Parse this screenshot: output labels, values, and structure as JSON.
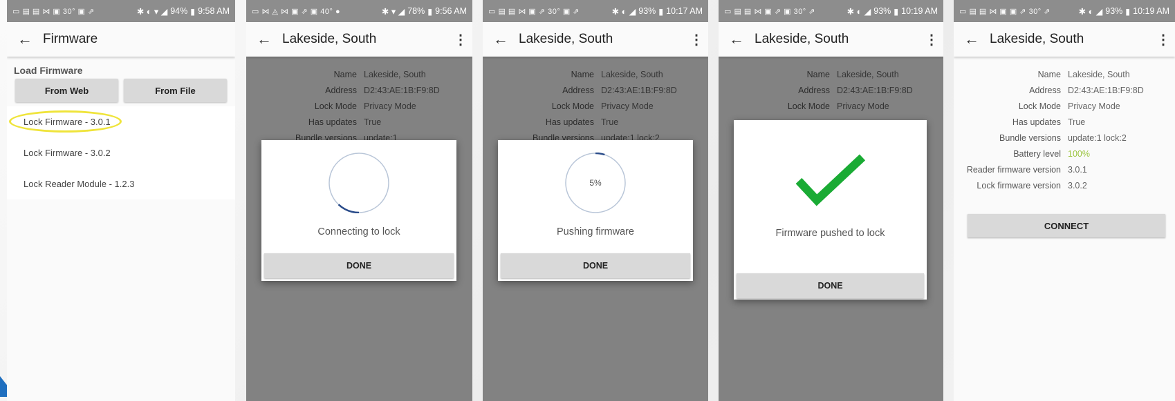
{
  "screens": [
    {
      "status": {
        "icons_left": "▭ ▤ ▤ ⋈ ▣ 30° ▣ ⇗",
        "battery": "94%",
        "time": "9:58 AM"
      },
      "title": "Firmware",
      "section_label": "Load Firmware",
      "buttons": [
        "From Web",
        "From File"
      ],
      "firmware_items": [
        "Lock Firmware - 3.0.1",
        "Lock Firmware - 3.0.2",
        "Lock Reader Module - 1.2.3"
      ]
    },
    {
      "status": {
        "icons_left": "▭ ⋈ ◬ ⋈ ▣ ⇗ ▣ 40° ●",
        "battery": "78%",
        "time": "9:56 AM"
      },
      "title": "Lakeside, South",
      "details": [
        {
          "label": "Name",
          "value": "Lakeside, South"
        },
        {
          "label": "Address",
          "value": "D2:43:AE:1B:F9:8D"
        },
        {
          "label": "Lock Mode",
          "value": "Privacy Mode"
        },
        {
          "label": "Has updates",
          "value": "True"
        },
        {
          "label": "Bundle versions",
          "value": "update:1"
        }
      ],
      "dialog": {
        "message": "Connecting to lock",
        "button": "DONE",
        "progress_text": "",
        "progress": 0.12
      }
    },
    {
      "status": {
        "icons_left": "▭ ▤ ▤ ⋈ ▣ ⇗ 30° ▣ ⇗",
        "battery": "93%",
        "time": "10:17 AM"
      },
      "title": "Lakeside, South",
      "details": [
        {
          "label": "Name",
          "value": "Lakeside, South"
        },
        {
          "label": "Address",
          "value": "D2:43:AE:1B:F9:8D"
        },
        {
          "label": "Lock Mode",
          "value": "Privacy Mode"
        },
        {
          "label": "Has updates",
          "value": "True"
        },
        {
          "label": "Bundle versions",
          "value": "update:1 lock:2"
        }
      ],
      "dialog": {
        "message": "Pushing firmware",
        "button": "DONE",
        "progress_text": "5%",
        "progress": 0.05
      }
    },
    {
      "status": {
        "icons_left": "▭ ▤ ▤ ⋈ ▣ ⇗ ▣ 30° ⇗",
        "battery": "93%",
        "time": "10:19 AM"
      },
      "title": "Lakeside, South",
      "details": [
        {
          "label": "Name",
          "value": "Lakeside, South"
        },
        {
          "label": "Address",
          "value": "D2:43:AE:1B:F9:8D"
        },
        {
          "label": "Lock Mode",
          "value": "Privacy Mode"
        }
      ],
      "dialog": {
        "message": "Firmware pushed to lock",
        "button": "DONE",
        "success_color": "#1aab34"
      }
    },
    {
      "status": {
        "icons_left": "▭ ▤ ▤ ⋈ ▣ ▣ ⇗ 30° ⇗",
        "battery": "93%",
        "time": "10:19 AM"
      },
      "title": "Lakeside, South",
      "details": [
        {
          "label": "Name",
          "value": "Lakeside, South"
        },
        {
          "label": "Address",
          "value": "D2:43:AE:1B:F9:8D"
        },
        {
          "label": "Lock Mode",
          "value": "Privacy Mode"
        },
        {
          "label": "Has updates",
          "value": "True"
        },
        {
          "label": "Bundle versions",
          "value": "update:1 lock:2"
        },
        {
          "label": "Battery level",
          "value": "100%"
        },
        {
          "label": "Reader firmware version",
          "value": "3.0.1"
        },
        {
          "label": "Lock firmware version",
          "value": "3.0.2"
        }
      ],
      "connect_label": "CONNECT",
      "battery_color": "#9bc53d"
    }
  ],
  "colors": {
    "status_bar": "#8d8d8d",
    "highlight_ring": "#efe43a",
    "spinner_track": "#b9c6d8",
    "spinner_arc": "#2a4c8a"
  }
}
